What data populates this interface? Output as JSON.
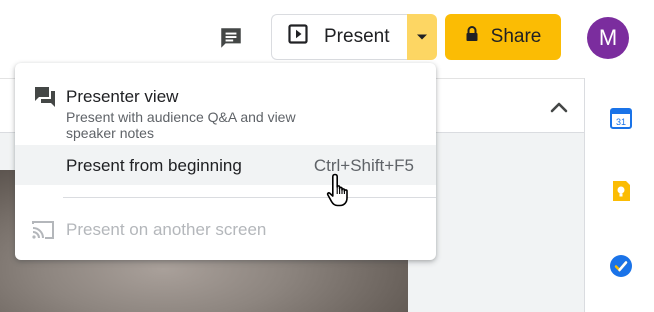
{
  "header": {
    "comment_icon": "comment-icon",
    "present": {
      "label": "Present",
      "icon": "present-play-icon",
      "dropdown_icon": "caret-down-icon"
    },
    "share": {
      "label": "Share",
      "icon": "lock-icon"
    },
    "avatar": {
      "initial": "M",
      "color": "#7b2d9e"
    },
    "accent_color": "#fbbc04"
  },
  "side_panel": {
    "apps": [
      {
        "name": "Calendar",
        "icon": "calendar-icon",
        "text": "31"
      },
      {
        "name": "Keep",
        "icon": "keep-icon"
      },
      {
        "name": "Tasks",
        "icon": "tasks-icon"
      }
    ]
  },
  "menu": {
    "presenter_view": {
      "title": "Presenter view",
      "description": "Present with audience Q&A and view speaker notes",
      "icon": "presenter-view-icon"
    },
    "present_from_beginning": {
      "title": "Present from beginning",
      "shortcut": "Ctrl+Shift+F5",
      "highlighted": true
    },
    "present_on_another_screen": {
      "title": "Present on another screen",
      "icon": "cast-icon",
      "disabled": true
    }
  }
}
